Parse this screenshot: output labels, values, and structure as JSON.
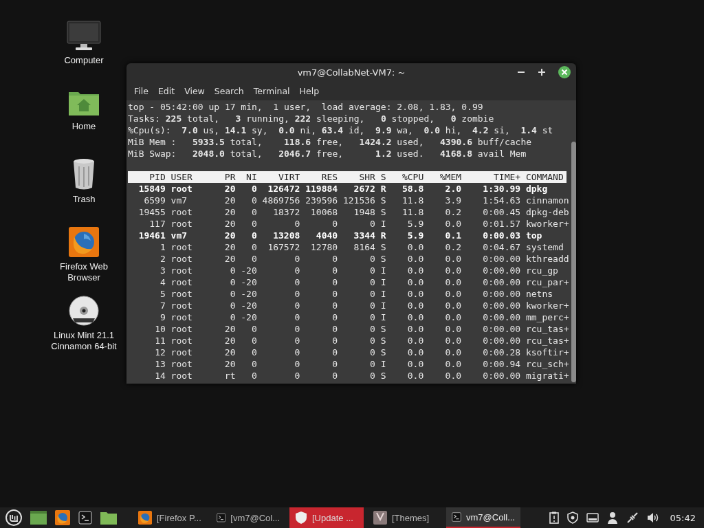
{
  "desktop_icons": [
    {
      "label": "Computer",
      "kind": "computer"
    },
    {
      "label": "Home",
      "kind": "home"
    },
    {
      "label": "Trash",
      "kind": "trash"
    },
    {
      "label": "Firefox Web Browser",
      "kind": "firefox"
    },
    {
      "label": "Linux Mint 21.1 Cinnamon 64-bit",
      "kind": "dvd"
    }
  ],
  "terminal": {
    "title": "vm7@CollabNet-VM7: ~",
    "menu": [
      "File",
      "Edit",
      "View",
      "Search",
      "Terminal",
      "Help"
    ],
    "summary": [
      "top - 05:42:00 up 17 min,  1 user,  load average: 2.08, 1.83, 0.99",
      "Tasks: **225** total,   **3** running, **222** sleeping,   **0** stopped,   **0** zombie",
      "%Cpu(s):  **7.0** us, **14.1** sy,  **0.0** ni, **63.4** id,  **9.9** wa,  **0.0** hi,  **4.2** si,  **1.4** st",
      "MiB Mem :   **5933.5** total,    **118.6** free,   **1424.2** used,   **4390.6** buff/cache",
      "MiB Swap:   **2048.0** total,   **2046.7** free,      **1.2** used.   **4168.8** avail Mem"
    ],
    "columns": [
      "PID",
      "USER",
      "PR",
      "NI",
      "VIRT",
      "RES",
      "SHR",
      "S",
      "%CPU",
      "%MEM",
      "TIME+",
      "COMMAND"
    ],
    "rows": [
      {
        "cells": [
          "15849",
          "root",
          "20",
          "0",
          "126472",
          "119884",
          "2672",
          "R",
          "58.8",
          "2.0",
          "1:30.99",
          "dpkg"
        ],
        "emphasized": true
      },
      {
        "cells": [
          "6599",
          "vm7",
          "20",
          "0",
          "4869756",
          "239596",
          "121536",
          "S",
          "11.8",
          "3.9",
          "1:54.63",
          "cinnamon"
        ],
        "emphasized": false
      },
      {
        "cells": [
          "19455",
          "root",
          "20",
          "0",
          "18372",
          "10068",
          "1948",
          "S",
          "11.8",
          "0.2",
          "0:00.45",
          "dpkg-deb"
        ],
        "emphasized": false
      },
      {
        "cells": [
          "117",
          "root",
          "20",
          "0",
          "0",
          "0",
          "0",
          "I",
          "5.9",
          "0.0",
          "0:01.57",
          "kworker+"
        ],
        "emphasized": false
      },
      {
        "cells": [
          "19461",
          "vm7",
          "20",
          "0",
          "13208",
          "4040",
          "3344",
          "R",
          "5.9",
          "0.1",
          "0:00.03",
          "top"
        ],
        "emphasized": true
      },
      {
        "cells": [
          "1",
          "root",
          "20",
          "0",
          "167572",
          "12780",
          "8164",
          "S",
          "0.0",
          "0.2",
          "0:04.67",
          "systemd"
        ],
        "emphasized": false
      },
      {
        "cells": [
          "2",
          "root",
          "20",
          "0",
          "0",
          "0",
          "0",
          "S",
          "0.0",
          "0.0",
          "0:00.00",
          "kthreadd"
        ],
        "emphasized": false
      },
      {
        "cells": [
          "3",
          "root",
          "0",
          "-20",
          "0",
          "0",
          "0",
          "I",
          "0.0",
          "0.0",
          "0:00.00",
          "rcu_gp"
        ],
        "emphasized": false
      },
      {
        "cells": [
          "4",
          "root",
          "0",
          "-20",
          "0",
          "0",
          "0",
          "I",
          "0.0",
          "0.0",
          "0:00.00",
          "rcu_par+"
        ],
        "emphasized": false
      },
      {
        "cells": [
          "5",
          "root",
          "0",
          "-20",
          "0",
          "0",
          "0",
          "I",
          "0.0",
          "0.0",
          "0:00.00",
          "netns"
        ],
        "emphasized": false
      },
      {
        "cells": [
          "7",
          "root",
          "0",
          "-20",
          "0",
          "0",
          "0",
          "I",
          "0.0",
          "0.0",
          "0:00.00",
          "kworker+"
        ],
        "emphasized": false
      },
      {
        "cells": [
          "9",
          "root",
          "0",
          "-20",
          "0",
          "0",
          "0",
          "I",
          "0.0",
          "0.0",
          "0:00.00",
          "mm_perc+"
        ],
        "emphasized": false
      },
      {
        "cells": [
          "10",
          "root",
          "20",
          "0",
          "0",
          "0",
          "0",
          "S",
          "0.0",
          "0.0",
          "0:00.00",
          "rcu_tas+"
        ],
        "emphasized": false
      },
      {
        "cells": [
          "11",
          "root",
          "20",
          "0",
          "0",
          "0",
          "0",
          "S",
          "0.0",
          "0.0",
          "0:00.00",
          "rcu_tas+"
        ],
        "emphasized": false
      },
      {
        "cells": [
          "12",
          "root",
          "20",
          "0",
          "0",
          "0",
          "0",
          "S",
          "0.0",
          "0.0",
          "0:00.28",
          "ksoftir+"
        ],
        "emphasized": false
      },
      {
        "cells": [
          "13",
          "root",
          "20",
          "0",
          "0",
          "0",
          "0",
          "I",
          "0.0",
          "0.0",
          "0:00.94",
          "rcu_sch+"
        ],
        "emphasized": false
      },
      {
        "cells": [
          "14",
          "root",
          "rt",
          "0",
          "0",
          "0",
          "0",
          "S",
          "0.0",
          "0.0",
          "0:00.00",
          "migrati+"
        ],
        "emphasized": false
      }
    ]
  },
  "taskbar": {
    "launchers": [
      {
        "kind": "menu"
      },
      {
        "kind": "desktop"
      },
      {
        "kind": "firefox"
      },
      {
        "kind": "terminal"
      },
      {
        "kind": "files"
      }
    ],
    "windows": [
      {
        "label": "[Firefox P...",
        "kind": "firefox",
        "selected": false,
        "urgent": false
      },
      {
        "label": "[vm7@Col...",
        "kind": "terminal",
        "selected": false,
        "urgent": false
      },
      {
        "label": "[Update ...",
        "kind": "shield",
        "selected": false,
        "urgent": true
      },
      {
        "label": "[Themes]",
        "kind": "themes",
        "selected": false,
        "urgent": false
      },
      {
        "label": "vm7@Coll...",
        "kind": "terminal",
        "selected": true,
        "urgent": false
      }
    ],
    "tray": [
      {
        "kind": "clipboard"
      },
      {
        "kind": "shield"
      },
      {
        "kind": "keyboard"
      },
      {
        "kind": "user"
      },
      {
        "kind": "network"
      },
      {
        "kind": "volume"
      }
    ],
    "clock": "05:42"
  }
}
